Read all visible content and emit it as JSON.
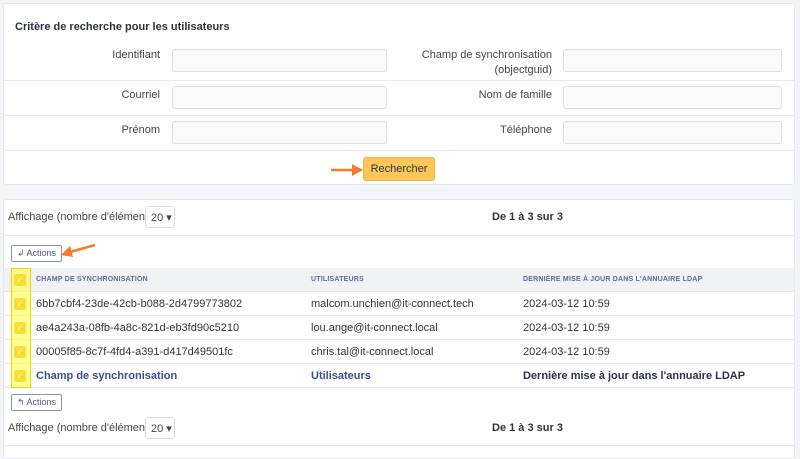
{
  "search": {
    "title": "Critère de recherche pour les utilisateurs",
    "fields": [
      {
        "label": "Identifiant",
        "value": ""
      },
      {
        "label": "Champ de synchronisation (objectguid)",
        "value": ""
      },
      {
        "label": "Courriel",
        "value": ""
      },
      {
        "label": "Nom de famille",
        "value": ""
      },
      {
        "label": "Prénom",
        "value": ""
      },
      {
        "label": "Téléphone",
        "value": ""
      }
    ],
    "search_label": "Rechercher"
  },
  "results": {
    "display_label": "Affichage (nombre d'éléments)",
    "page_size": "20 ▾",
    "pagination": "De 1 à 3 sur 3",
    "actions_label": "Actions",
    "columns": [
      "CHAMP DE SYNCHRONISATION",
      "UTILISATEURS",
      "DERNIÈRE MISE À JOUR DANS L'ANNUAIRE LDAP"
    ],
    "footer": [
      "Champ de synchronisation",
      "Utilisateurs",
      "Dernière mise à jour dans l'annuaire LDAP"
    ],
    "rows": [
      {
        "sync": "6bb7cbf4-23de-42cb-b088-2d4799773802",
        "user": "malcom.unchien@it-connect.tech",
        "updated": "2024-03-12 10:59"
      },
      {
        "sync": "ae4a243a-08fb-4a8c-821d-eb3fd90c5210",
        "user": "lou.ange@it-connect.local",
        "updated": "2024-03-12 10:59"
      },
      {
        "sync": "00005f85-8c7f-4fd4-a391-d417d49501fc",
        "user": "chris.tal@it-connect.local",
        "updated": "2024-03-12 10:59"
      }
    ]
  },
  "colors": {
    "accent": "#fcc75a",
    "highlight": "#ffff3c",
    "arrow": "#f57c2a",
    "link": "#3c4f8e"
  },
  "icons": {
    "checkbox": "✓",
    "actions_top": "↲",
    "actions_bottom": "↰"
  }
}
